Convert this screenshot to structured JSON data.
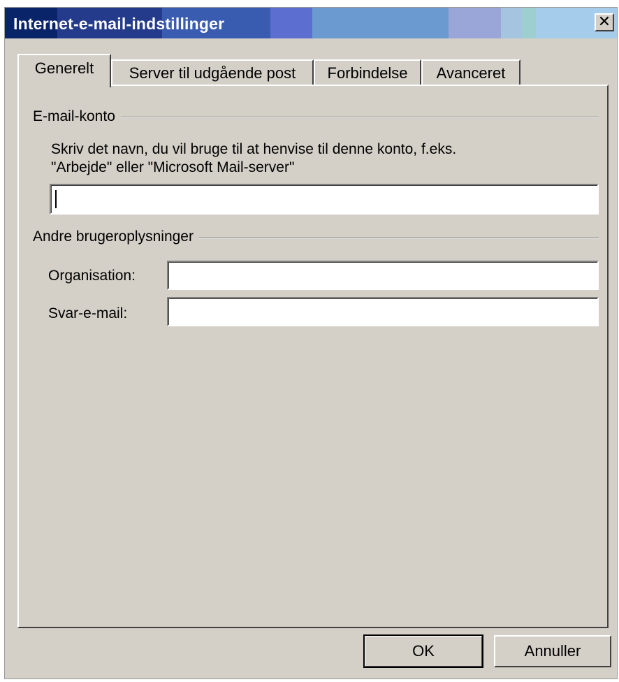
{
  "window": {
    "title": "Internet-e-mail-indstillinger",
    "close_label": "✕"
  },
  "tabs": [
    {
      "label": "Generelt",
      "active": true
    },
    {
      "label": "Server til udgående post",
      "active": false
    },
    {
      "label": "Forbindelse",
      "active": false
    },
    {
      "label": "Avanceret",
      "active": false
    }
  ],
  "email_account": {
    "group_label": "E-mail-konto",
    "description_line1": "Skriv det navn, du vil bruge til at henvise til denne konto, f.eks.",
    "description_line2": "\"Arbejde\" eller \"Microsoft Mail-server\"",
    "account_name_value": ""
  },
  "user_info": {
    "group_label": "Andre brugeroplysninger",
    "organisation_label": "Organisation:",
    "organisation_value": "",
    "reply_email_label": "Svar-e-mail:",
    "reply_email_value": ""
  },
  "buttons": {
    "ok_label": "OK",
    "cancel_label": "Annuller"
  }
}
